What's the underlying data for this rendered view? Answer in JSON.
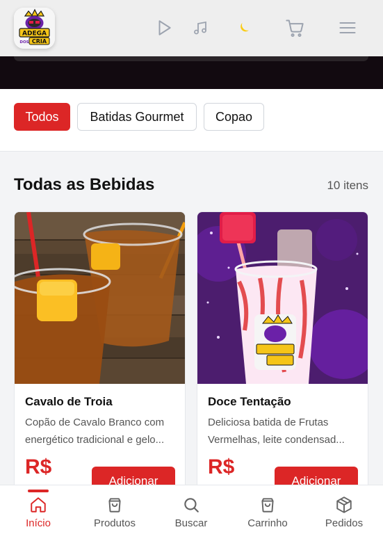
{
  "app": {
    "brand_logo_text": [
      "ADEGA",
      "DOS",
      "CRIA"
    ]
  },
  "header": {
    "icons": [
      "play-icon",
      "music-note-icon",
      "moon-icon",
      "cart-icon",
      "menu-icon"
    ]
  },
  "categories": [
    {
      "label": "Todos",
      "active": true
    },
    {
      "label": "Batidas Gourmet",
      "active": false
    },
    {
      "label": "Copao",
      "active": false
    }
  ],
  "section": {
    "title": "Todas as Bebidas",
    "count": "10 itens"
  },
  "products": [
    {
      "name": "Cavalo de Troia",
      "description_line1": "Copão de Cavalo Branco com",
      "description_line2": "energético tradicional e gelo...",
      "price": "R$",
      "button": "Adicionar"
    },
    {
      "name": "Doce Tentação",
      "description_line1": "Deliciosa batida de Frutas",
      "description_line2": "Vermelhas, leite condensad...",
      "price": "R$",
      "button": "Adicionar"
    }
  ],
  "bottom_nav": [
    {
      "label": "Início",
      "icon": "home-icon",
      "active": true
    },
    {
      "label": "Produtos",
      "icon": "shopping-bag-icon",
      "active": false
    },
    {
      "label": "Buscar",
      "icon": "search-icon",
      "active": false
    },
    {
      "label": "Carrinho",
      "icon": "bag-icon",
      "active": false
    },
    {
      "label": "Pedidos",
      "icon": "package-icon",
      "active": false
    }
  ],
  "colors": {
    "accent": "#dc2626",
    "moon": "#facc15",
    "hero": "#120a10"
  }
}
